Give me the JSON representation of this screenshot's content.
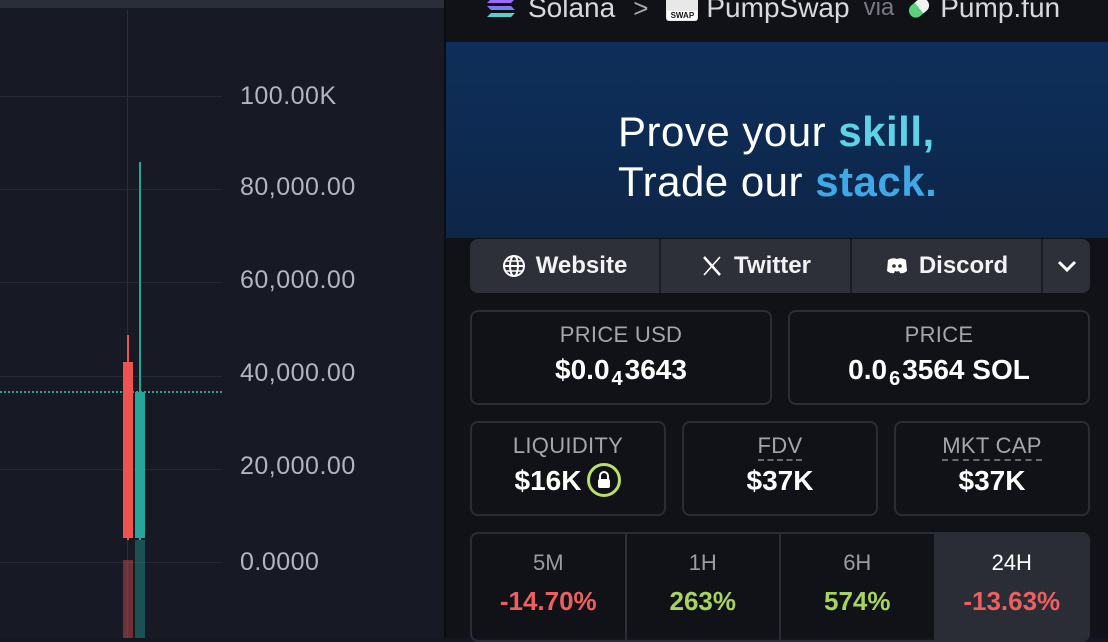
{
  "chart": {
    "y_axis_labels": [
      "100.00K",
      "80,000.00",
      "60,000.00",
      "40,000.00",
      "20,000.00",
      "0.0000"
    ],
    "colors": {
      "up": "#26a69a",
      "down": "#ef5350",
      "grid": "#262a36"
    }
  },
  "breadcrumb": {
    "chain": "Solana",
    "dex": "PumpSwap",
    "dex_icon_text": "SWAP",
    "via": "via",
    "launchpad": "Pump.fun"
  },
  "banner": {
    "line1_prefix": "Prove your ",
    "line1_highlight": "skill,",
    "line2_prefix": "Trade our ",
    "line2_highlight": "stack."
  },
  "links": {
    "website": "Website",
    "twitter": "Twitter",
    "discord": "Discord"
  },
  "stats": {
    "price_usd": {
      "label": "PRICE USD",
      "prefix": "$0.0",
      "zeros": "4",
      "suffix": "3643"
    },
    "price_sol": {
      "label": "PRICE",
      "prefix": "0.0",
      "zeros": "6",
      "suffix": "3564 SOL"
    },
    "liquidity": {
      "label": "LIQUIDITY",
      "value": "$16K"
    },
    "fdv": {
      "label": "FDV",
      "value": "$37K"
    },
    "mkt_cap": {
      "label": "MKT CAP",
      "value": "$37K"
    }
  },
  "periods": [
    {
      "label": "5M",
      "change": "-14.70%",
      "color": "#ef5f5f"
    },
    {
      "label": "1H",
      "change": "263%",
      "color": "#a6d45e"
    },
    {
      "label": "6H",
      "change": "574%",
      "color": "#a6d45e"
    },
    {
      "label": "24H",
      "change": "-13.63%",
      "color": "#ef5f5f"
    }
  ]
}
